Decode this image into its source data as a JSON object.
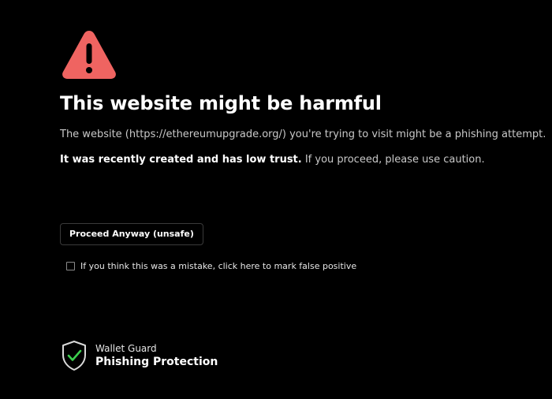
{
  "colors": {
    "background": "#000000",
    "warning": "#ef6461",
    "shield_check": "#3ccf4e",
    "text_primary": "#ffffff",
    "text_secondary": "#c9c9c9"
  },
  "warning": {
    "icon": "warning-triangle-icon",
    "title": "This website might be harmful",
    "description": "The website (https://ethereumupgrade.org/) you're trying to visit might be a phishing attempt.",
    "trust_strong": "It was recently created and has low trust.",
    "trust_rest": " If you proceed, please use caution."
  },
  "actions": {
    "proceed_label": "Proceed Anyway (unsafe)",
    "false_positive_label": "If you think this was a mistake, click here to mark false positive",
    "false_positive_checked": false
  },
  "brand": {
    "icon": "shield-check-icon",
    "name": "Wallet Guard",
    "product": "Phishing Protection"
  }
}
